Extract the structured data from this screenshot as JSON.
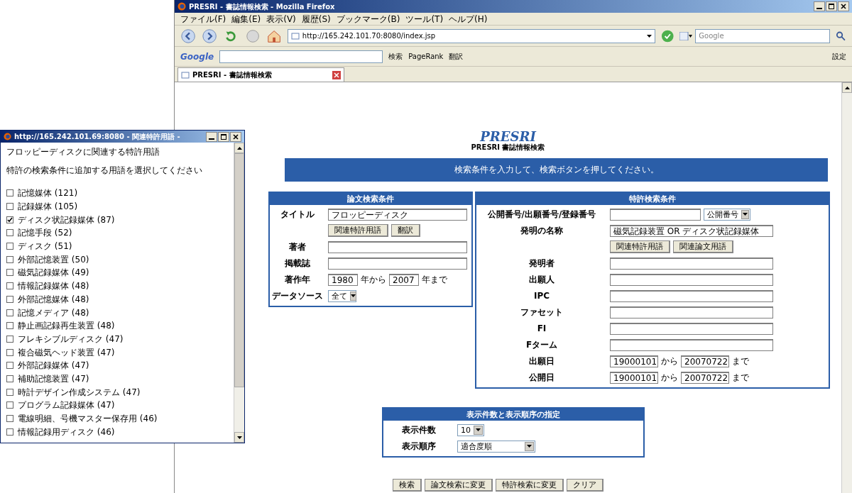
{
  "browser": {
    "title": "PRESRI - 書誌情報検索 - Mozilla Firefox",
    "menu": [
      "ファイル(F)",
      "編集(E)",
      "表示(V)",
      "履歴(S)",
      "ブックマーク(B)",
      "ツール(T)",
      "ヘルプ(H)"
    ],
    "url": "http://165.242.101.70:8080/index.jsp",
    "search_placeholder": "Google",
    "google_toolbar": {
      "logo": "Google",
      "items": [
        "検索",
        "PageRank",
        "翻訳"
      ],
      "settings": "設定"
    },
    "tab": "PRESRI - 書誌情報検索"
  },
  "page": {
    "logo": "PRESRI",
    "subtitle": "PRESRI 書誌情報検索",
    "banner": "検索条件を入力して、検索ボタンを押してください。",
    "paper_panel": {
      "title": "論文検索条件",
      "rows": [
        {
          "kind": "text",
          "label": "タイトル",
          "value": "フロッピーディスク"
        },
        {
          "kind": "buttons",
          "buttons": [
            "関連特許用語",
            "翻訳"
          ]
        },
        {
          "kind": "text",
          "label": "著者"
        },
        {
          "kind": "text",
          "label": "掲載誌"
        },
        {
          "kind": "range",
          "label": "著作年",
          "from": "1980",
          "from_suffix": "年から",
          "to": "2007",
          "to_suffix": "年まで"
        },
        {
          "kind": "select",
          "label": "データソース",
          "value": "全て"
        }
      ]
    },
    "patent_panel": {
      "title": "特許検索条件",
      "rows": [
        {
          "kind": "text_select",
          "label": "公開番号/出願番号/登録番号",
          "select": "公開番号"
        },
        {
          "kind": "text",
          "label": "発明の名称",
          "value": "磁気記録装置 OR ディスク状記録媒体"
        },
        {
          "kind": "buttons",
          "buttons": [
            "関連特許用語",
            "関連論文用語"
          ]
        },
        {
          "kind": "text",
          "label": "発明者"
        },
        {
          "kind": "text",
          "label": "出願人"
        },
        {
          "kind": "text",
          "label": "IPC"
        },
        {
          "kind": "text",
          "label": "ファセット"
        },
        {
          "kind": "text",
          "label": "FI"
        },
        {
          "kind": "text",
          "label": "Fターム"
        },
        {
          "kind": "range",
          "label": "出願日",
          "from": "19000101",
          "from_suffix": "から",
          "to": "20070722",
          "to_suffix": "まで"
        },
        {
          "kind": "range",
          "label": "公開日",
          "from": "19000101",
          "from_suffix": "から",
          "to": "20070722",
          "to_suffix": "まで"
        }
      ]
    },
    "display_panel": {
      "title": "表示件数と表示順序の指定",
      "rows": [
        {
          "kind": "select",
          "label": "表示件数",
          "value": "10"
        },
        {
          "kind": "wide_select",
          "label": "表示順序",
          "value": "適合度順"
        }
      ]
    },
    "actions": [
      "検索",
      "論文検索に変更",
      "特許検索に変更",
      "クリア"
    ]
  },
  "popup": {
    "title": "http://165.242.101.69:8080 - 関連特許用語 -",
    "heading": "フロッピーディスクに関連する特許用語",
    "instruction": "特許の検索条件に追加する用語を選択してください",
    "terms": [
      {
        "label": "記憶媒体 (121)",
        "checked": false
      },
      {
        "label": "記録媒体 (105)",
        "checked": false
      },
      {
        "label": "ディスク状記録媒体 (87)",
        "checked": true
      },
      {
        "label": "記憶手段 (52)",
        "checked": false
      },
      {
        "label": "ディスク (51)",
        "checked": false
      },
      {
        "label": "外部記憶装置 (50)",
        "checked": false
      },
      {
        "label": "磁気記録媒体 (49)",
        "checked": false
      },
      {
        "label": "情報記録媒体 (48)",
        "checked": false
      },
      {
        "label": "外部記憶媒体 (48)",
        "checked": false
      },
      {
        "label": "記憶メディア (48)",
        "checked": false
      },
      {
        "label": "静止画記録再生装置 (48)",
        "checked": false
      },
      {
        "label": "フレキシブルディスク (47)",
        "checked": false
      },
      {
        "label": "複合磁気ヘッド装置 (47)",
        "checked": false
      },
      {
        "label": "外部記録媒体 (47)",
        "checked": false
      },
      {
        "label": "補助記憶装置 (47)",
        "checked": false
      },
      {
        "label": "時計デザイン作成システム (47)",
        "checked": false
      },
      {
        "label": "プログラム記録媒体 (47)",
        "checked": false
      },
      {
        "label": "電線明細、号機マスター保存用 (46)",
        "checked": false
      },
      {
        "label": "情報記録用ディスク (46)",
        "checked": false
      }
    ]
  }
}
